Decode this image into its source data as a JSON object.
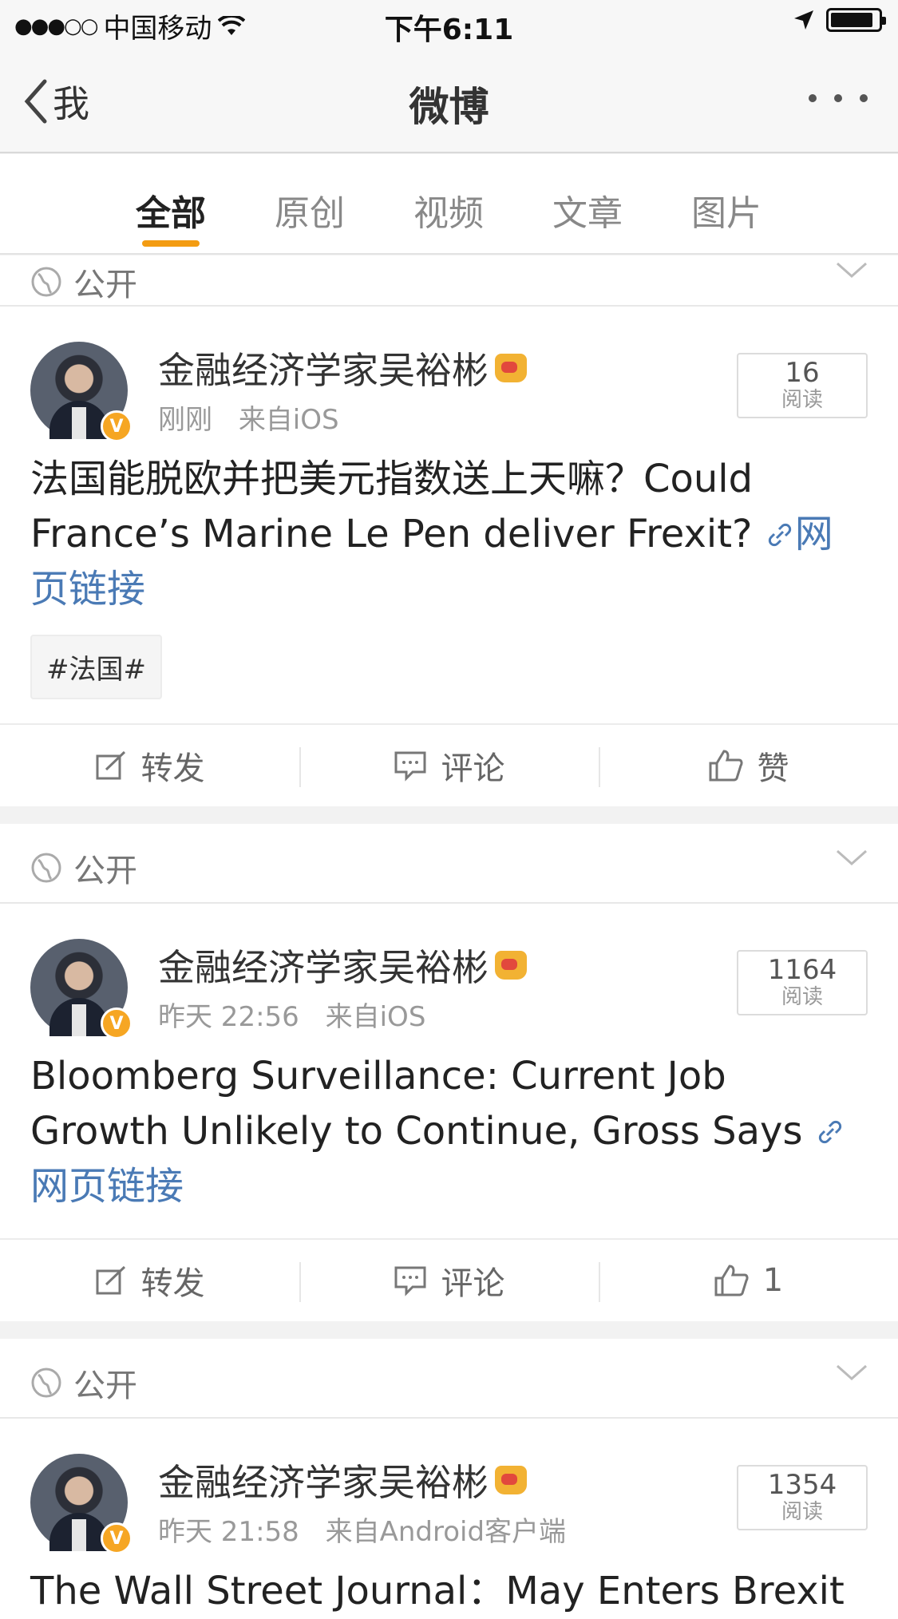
{
  "status_bar": {
    "carrier": "中国移动",
    "time": "下午6:11"
  },
  "nav": {
    "back_label": "我",
    "title": "微博"
  },
  "tabs": [
    {
      "label": "全部"
    },
    {
      "label": "原创"
    },
    {
      "label": "视频"
    },
    {
      "label": "文章"
    },
    {
      "label": "图片"
    }
  ],
  "colors": {
    "accent": "#f39c12",
    "link": "#4a7ab5",
    "verified_badge": "#f6a623"
  },
  "visibility_label": "公开",
  "actions": {
    "repost": "转发",
    "comment": "评论",
    "like": "赞"
  },
  "posts": [
    {
      "author": "金融经济学家吴裕彬",
      "time": "刚刚",
      "source": "来自iOS",
      "read_count": "16",
      "read_label": "阅读",
      "text": "法国能脱欧并把美元指数送上天嘛？Could France’s Marine Le Pen deliver Frexit?",
      "link_text": "网页链接",
      "topic": "#法国#",
      "like_text": "赞"
    },
    {
      "author": "金融经济学家吴裕彬",
      "time": "昨天 22:56",
      "source": "来自iOS",
      "read_count": "1164",
      "read_label": "阅读",
      "text": "Bloomberg Surveillance: Current Job Growth Unlikely to Continue, Gross Says",
      "link_text": "网页链接",
      "like_text": "1"
    },
    {
      "author": "金融经济学家吴裕彬",
      "time": "昨天 21:58",
      "source": "来自Android客户端",
      "read_count": "1354",
      "read_label": "阅读",
      "text": "The Wall Street Journal：May Enters Brexit"
    }
  ]
}
